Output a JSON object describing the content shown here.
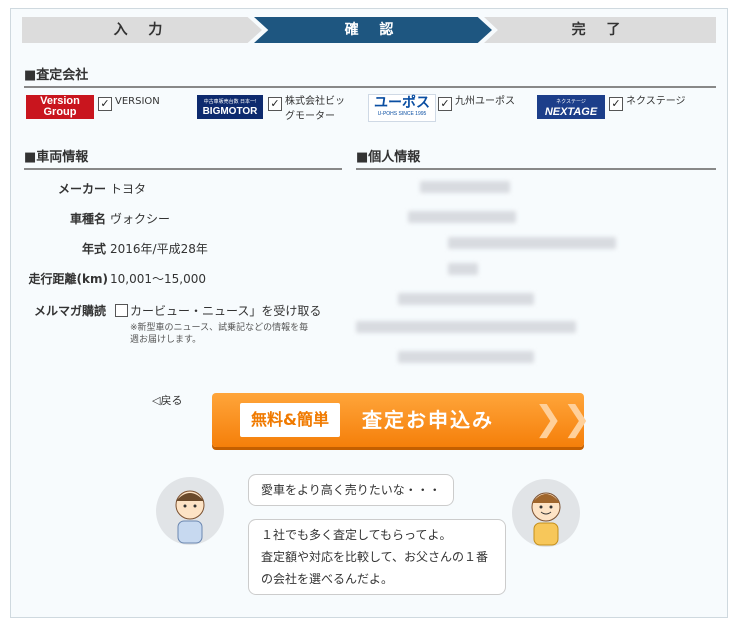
{
  "steps": [
    "入 力",
    "確 認",
    "完 了"
  ],
  "sections": {
    "company_title": "■査定会社",
    "car_title": "■車両情報",
    "personal_title": "■個人情報"
  },
  "companies": [
    {
      "logo_text": "Version Group",
      "name": "VERSION",
      "checked": true
    },
    {
      "logo_text": "BIGMOTOR",
      "logo_sub": "中古車販売台数 日本一!",
      "name_line1": "株式会社ビッ",
      "name_line2": "グモーター",
      "checked": true
    },
    {
      "logo_text": "ユーポス",
      "logo_sub": "U-POHS SINCE 1995",
      "name": "九州ユーポス",
      "checked": true
    },
    {
      "logo_text": "NEXTAGE",
      "logo_sub": "ネクステージ",
      "name": "ネクステージ",
      "checked": true
    }
  ],
  "car": {
    "maker_label": "メーカー",
    "maker_value": "トヨタ",
    "model_label": "車種名",
    "model_value": "ヴォクシー",
    "year_label": "年式",
    "year_value": "2016年/平成28年",
    "mileage_label": "走行距離(km)",
    "mileage_value": "10,001〜15,000",
    "mail_label": "メルマガ購読",
    "mail_checkbox_label": "カービュー・ニュース」を受け取る",
    "mail_note_1": "※新型車のニュース、試乗記などの情報を毎",
    "mail_note_2": "週お届けします。"
  },
  "back_link": "◁戻る",
  "cta": {
    "badge": "無料&簡単",
    "label": "査定お申込み",
    "arrow": "❯❯"
  },
  "bubbles": {
    "father": "愛車をより高く売りたいな・・・",
    "son_1": "１社でも多く査定してもらってよ。",
    "son_2": "査定額や対応を比較して、お父さんの１番",
    "son_3": "の会社を選べるんだよ。"
  },
  "colors": {
    "step_active": "#1e5680",
    "step_inactive": "#dcdcdc",
    "cta": "#f57f0a"
  }
}
